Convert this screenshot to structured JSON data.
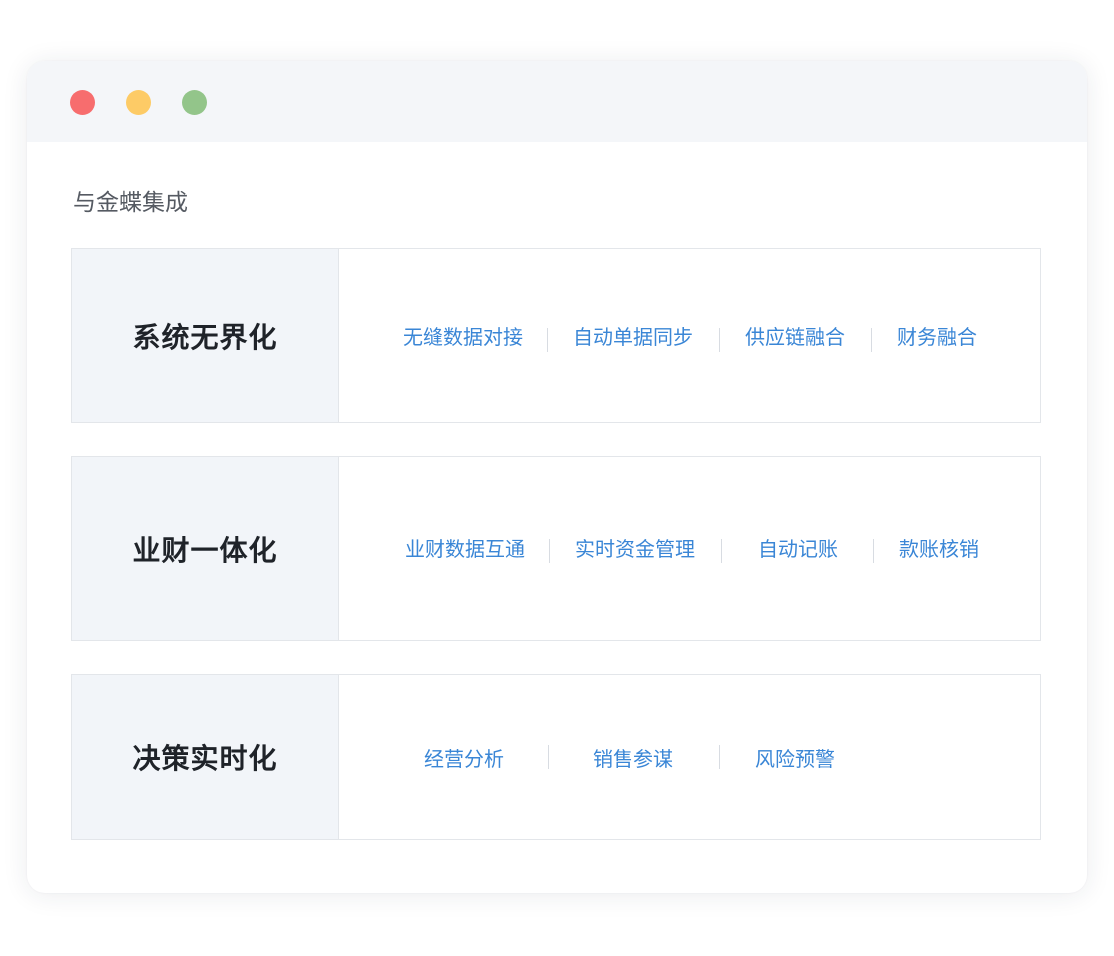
{
  "window": {
    "controls": {
      "close_color": "#f76d6e",
      "minimize_color": "#fdcb66",
      "maximize_color": "#93c58a"
    }
  },
  "section": {
    "title": "与金蝶集成"
  },
  "cards": [
    {
      "heading": "系统无界化",
      "features": [
        "无缝数据对接",
        "自动单据同步",
        "供应链融合",
        "财务融合"
      ]
    },
    {
      "heading": "业财一体化",
      "features": [
        "业财数据互通",
        "实时资金管理",
        "自动记账",
        "款账核销"
      ]
    },
    {
      "heading": "决策实时化",
      "features": [
        "经营分析",
        "销售参谋",
        "风险预警"
      ]
    }
  ],
  "colors": {
    "accent_link": "#3a86d6",
    "heading_text": "#1f2329",
    "heading_bg": "#f2f5f9"
  }
}
